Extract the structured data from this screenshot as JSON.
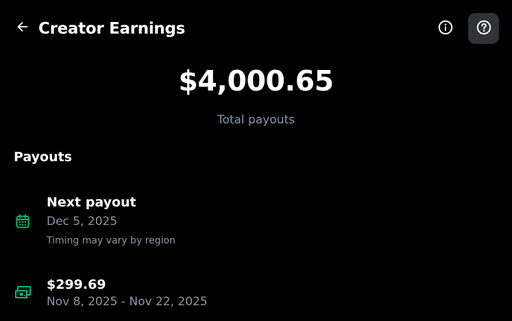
{
  "header": {
    "title": "Creator Earnings",
    "back_icon": "arrow-left-icon",
    "info_icon": "info-circle-icon",
    "help_icon": "question-circle-icon"
  },
  "summary": {
    "total_amount": "$4,000.65",
    "total_label": "Total payouts"
  },
  "payouts": {
    "section_title": "Payouts",
    "next_payout": {
      "icon": "calendar-icon",
      "title": "Next payout",
      "date": "Dec 5, 2025",
      "note": "Timing may vary by region"
    },
    "items": [
      {
        "icon": "money-icon",
        "amount": "$299.69",
        "period": "Nov 8, 2025 - Nov 22, 2025"
      }
    ]
  },
  "colors": {
    "background": "#000000",
    "primary_text": "#ffffff",
    "secondary_text": "#8b98a5",
    "accent_green": "#00ba7c",
    "help_button_bg": "#2f3336"
  }
}
